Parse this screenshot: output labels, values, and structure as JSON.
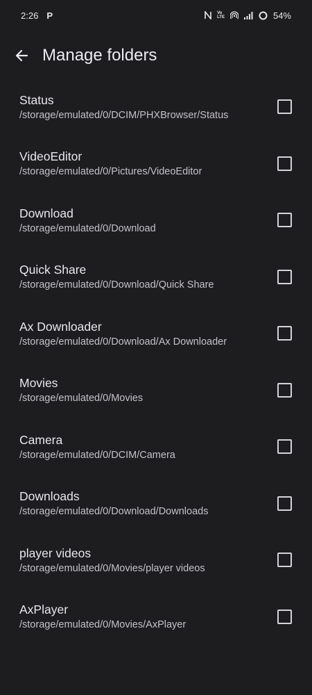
{
  "status_bar": {
    "time": "2:26",
    "app_indicator": "P",
    "battery_percent": "54%",
    "network_label_top": "Vo",
    "network_label_bottom": "LTE"
  },
  "app_bar": {
    "title": "Manage folders"
  },
  "folders": [
    {
      "name": "Status",
      "path": "/storage/emulated/0/DCIM/PHXBrowser/Status",
      "checked": false
    },
    {
      "name": "VideoEditor",
      "path": "/storage/emulated/0/Pictures/VideoEditor",
      "checked": false
    },
    {
      "name": "Download",
      "path": "/storage/emulated/0/Download",
      "checked": false
    },
    {
      "name": "Quick Share",
      "path": "/storage/emulated/0/Download/Quick Share",
      "checked": false
    },
    {
      "name": "Ax Downloader",
      "path": "/storage/emulated/0/Download/Ax Downloader",
      "checked": false
    },
    {
      "name": "Movies",
      "path": "/storage/emulated/0/Movies",
      "checked": false
    },
    {
      "name": "Camera",
      "path": "/storage/emulated/0/DCIM/Camera",
      "checked": false
    },
    {
      "name": "Downloads",
      "path": "/storage/emulated/0/Download/Downloads",
      "checked": false
    },
    {
      "name": "player videos",
      "path": "/storage/emulated/0/Movies/player videos",
      "checked": false
    },
    {
      "name": "AxPlayer",
      "path": "/storage/emulated/0/Movies/AxPlayer",
      "checked": false
    }
  ],
  "icons": {
    "back": "arrow-back-icon",
    "nfc": "nfc-icon",
    "hotspot": "hotspot-icon",
    "signal": "signal-icon",
    "battery": "battery-ring-icon"
  }
}
